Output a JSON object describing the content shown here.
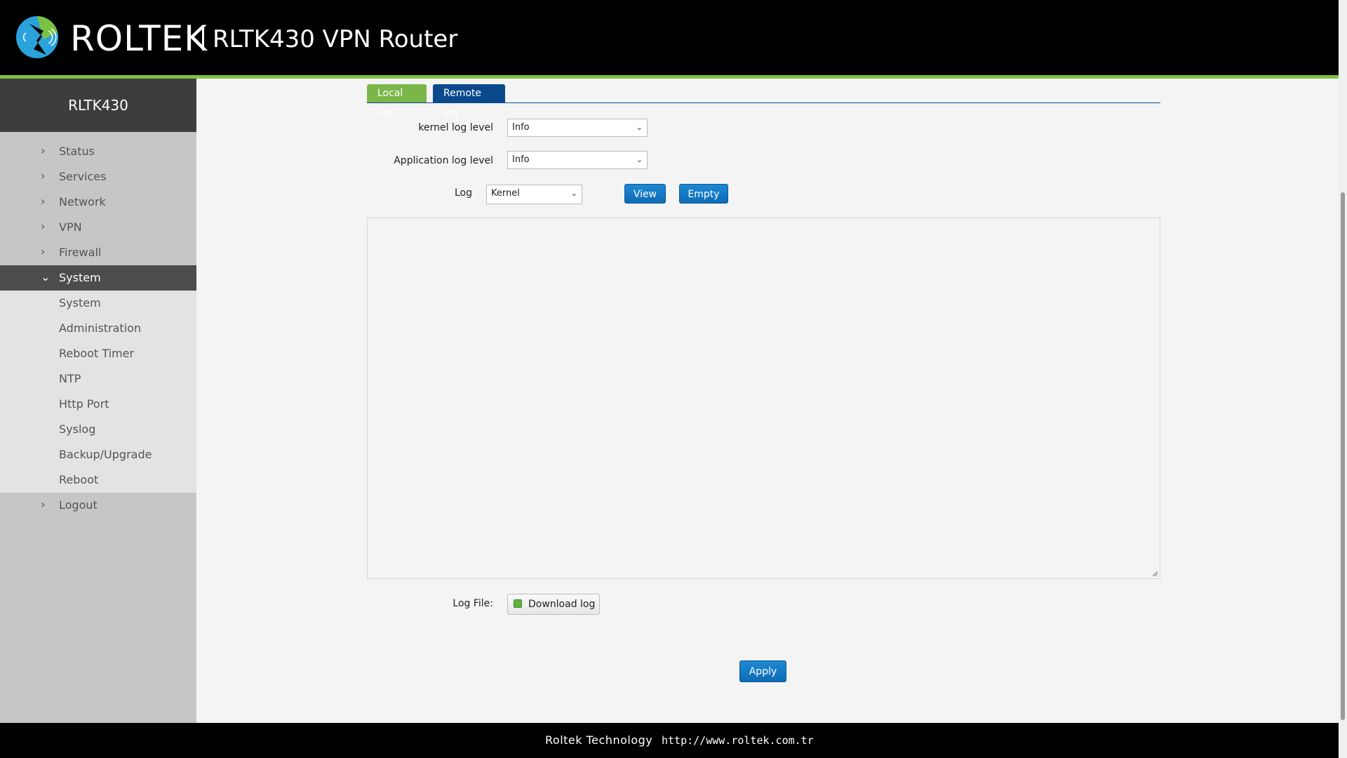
{
  "header": {
    "brand": "ROLTEK",
    "product_title": "RLTK430 VPN Router",
    "colors": {
      "background": "#000000",
      "accent_stripe": "#7cc242",
      "logo_blue": "#2aa3dc"
    }
  },
  "sidebar": {
    "device_name": "RLTK430",
    "items": [
      {
        "label": "Status"
      },
      {
        "label": "Services"
      },
      {
        "label": "Network"
      },
      {
        "label": "VPN"
      },
      {
        "label": "Firewall"
      },
      {
        "label": "System",
        "expanded": true
      },
      {
        "label": "Logout"
      }
    ],
    "system_subitems": [
      {
        "label": "System"
      },
      {
        "label": "Administration"
      },
      {
        "label": "Reboot Timer"
      },
      {
        "label": "NTP"
      },
      {
        "label": "Http Port"
      },
      {
        "label": "Syslog"
      },
      {
        "label": "Backup/Upgrade"
      },
      {
        "label": "Reboot"
      }
    ]
  },
  "tabs": {
    "local": "Local log",
    "remote": "Remote log"
  },
  "form": {
    "kernel_level_label": "kernel log level",
    "kernel_level_value": "Info",
    "app_level_label": "Application log level",
    "app_level_value": "Info",
    "log_label": "Log",
    "log_value": "Kernel",
    "view_button": "View",
    "empty_button": "Empty",
    "log_content": "",
    "log_file_label": "Log File:",
    "download_button": "Download log",
    "apply_button": "Apply"
  },
  "footer": {
    "company": "Roltek Technology",
    "url": "http://www.roltek.com.tr"
  }
}
